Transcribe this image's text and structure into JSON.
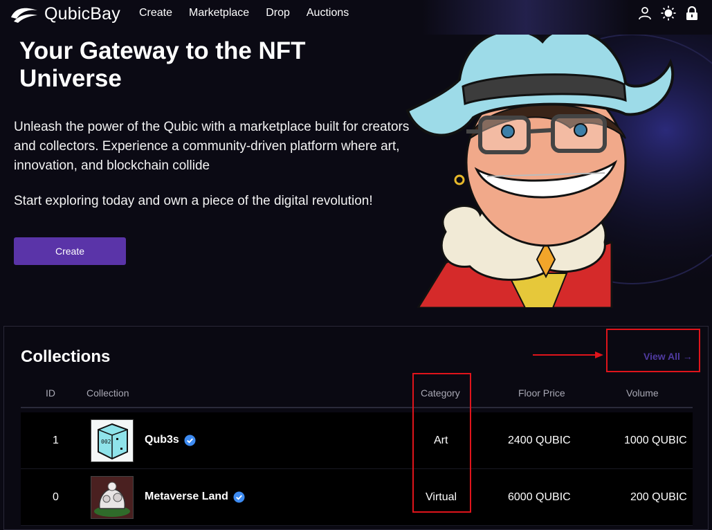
{
  "nav": {
    "brand": "QubicBay",
    "links": [
      "Create",
      "Marketplace",
      "Drop",
      "Auctions"
    ],
    "icons": [
      "user-icon",
      "sun-icon",
      "lock-icon"
    ]
  },
  "hero": {
    "title": "Your Gateway to the NFT Universe",
    "description": "Unleash the power of the Qubic with a marketplace built for creators and collectors. Experience a community-driven platform where art, innovation, and blockchain collide",
    "cta_text": "Start exploring today and own a piece of the digital revolution!",
    "button_label": "Create"
  },
  "collections": {
    "title": "Collections",
    "view_all": "View All →",
    "headers": [
      "ID",
      "Collection",
      "Category",
      "Floor Price",
      "Volume"
    ],
    "rows": [
      {
        "id": "1",
        "name": "Qub3s",
        "category": "Art",
        "floor_price": "2400 QUBIC",
        "volume": "1000 QUBIC"
      },
      {
        "id": "0",
        "name": "Metaverse Land",
        "category": "Virtual",
        "floor_price": "6000 QUBIC",
        "volume": "200 QUBIC"
      }
    ]
  },
  "colors": {
    "accent": "#5a34a8",
    "link": "#4f3aa0",
    "annotation": "#e0141b",
    "verified": "#3d8bf2"
  }
}
